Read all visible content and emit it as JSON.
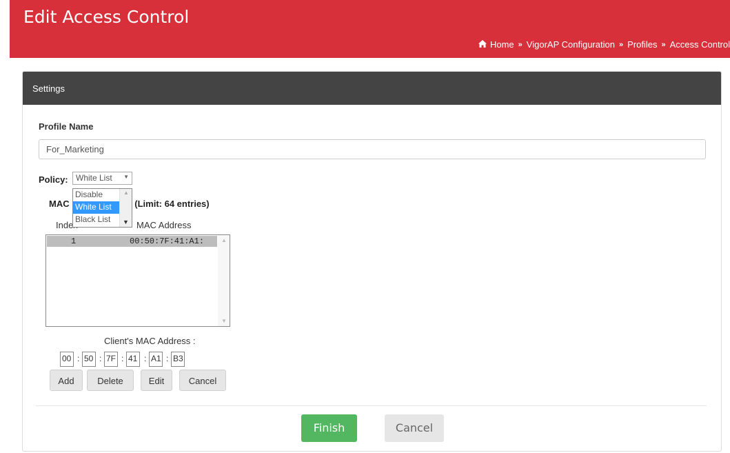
{
  "header": {
    "title": "Edit Access Control",
    "breadcrumb": [
      "Home",
      "VigorAP Configuration",
      "Profiles",
      "Access Control"
    ],
    "separator": "»"
  },
  "panel": {
    "title": "Settings"
  },
  "profile": {
    "label": "Profile Name",
    "value": "For_Marketing"
  },
  "policy": {
    "label": "Policy:",
    "selected": "White List",
    "options": [
      "Disable",
      "White List",
      "Black List"
    ]
  },
  "mac_filter": {
    "title_prefix": "MAC",
    "title_suffix": "er (Limit: 64 entries)",
    "col_index": "Index",
    "col_mac": "MAC Address",
    "rows": [
      {
        "index": "1",
        "mac": "00:50:7F:41:A1:"
      }
    ]
  },
  "client_mac": {
    "label": "Client's MAC Address :",
    "octets": [
      "00",
      "50",
      "7F",
      "41",
      "A1",
      "B3"
    ]
  },
  "buttons": {
    "add": "Add",
    "delete": "Delete",
    "edit": "Edit",
    "cancel_small": "Cancel",
    "finish": "Finish",
    "cancel": "Cancel"
  },
  "colors": {
    "header": "#d7303a",
    "panel_head": "#444444",
    "finish": "#52b760",
    "selection": "#3399ff"
  }
}
